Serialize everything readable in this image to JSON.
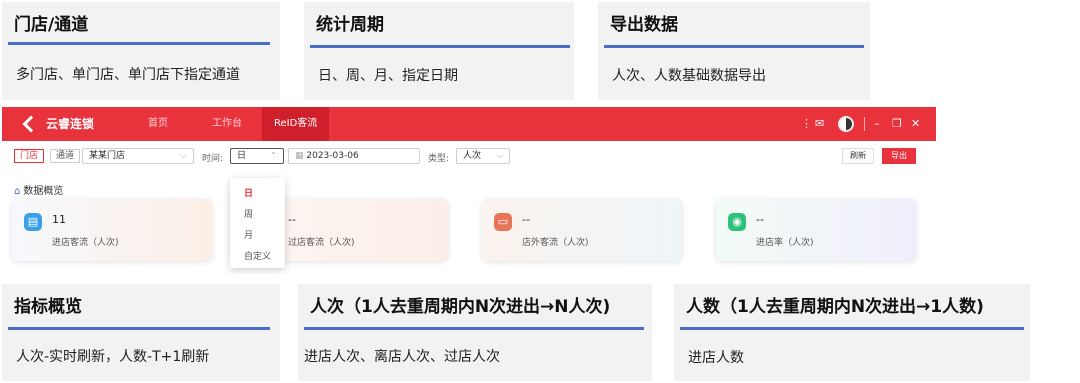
{
  "cards": {
    "store_channel": {
      "title": "门店/通道",
      "desc": "多门店、单门店、单门店下指定通道"
    },
    "period": {
      "title": "统计周期",
      "desc": "日、周、月、指定日期"
    },
    "export": {
      "title": "导出数据",
      "desc": "人次、人数基础数据导出"
    },
    "overview": {
      "title": "指标概览",
      "desc": "人次-实时刷新，人数-T+1刷新"
    },
    "visits": {
      "title": "人次（1人去重周期内N次进出→N人次)",
      "desc": "进店人次、离店人次、过店人次"
    },
    "people": {
      "title": "人数（1人去重周期内N次进出→1人数)",
      "desc": "进店人数"
    }
  },
  "app": {
    "brand": "云睿连锁",
    "nav": [
      "首页",
      "工作台",
      "ReID客流"
    ],
    "window_controls": {
      "menu": "⋮",
      "message": "✉",
      "minimize": "–",
      "restore": "❐",
      "close": "✕"
    },
    "filters": {
      "store_tab": "门店",
      "channel_tab": "通道",
      "store_select_value": "某某门店",
      "time_label": "时间:",
      "time_value": "日",
      "date_value": "2023-03-06",
      "type_label": "类型:",
      "type_value": "人次",
      "refresh": "刷新",
      "export": "导出"
    },
    "section_title": "数据概览",
    "stats": [
      {
        "value": "11",
        "label": "进店客流（人次)",
        "icon": "store-enter-icon",
        "color": "#3aa0e8"
      },
      {
        "value": "--",
        "label": "过店客流（人次)",
        "icon": "pass-by-icon",
        "color": "#e8a040"
      },
      {
        "value": "--",
        "label": "店外客流（人次)",
        "icon": "outside-icon",
        "color": "#e8745a"
      },
      {
        "value": "--",
        "label": "进店率（人次)",
        "icon": "rate-icon",
        "color": "#2cc27a"
      }
    ],
    "time_dropdown": [
      "日",
      "周",
      "月",
      "自定义"
    ]
  }
}
